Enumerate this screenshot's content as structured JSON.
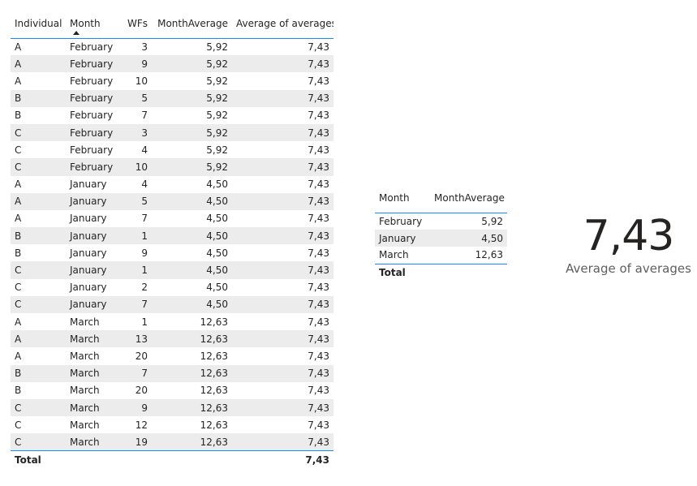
{
  "main_table": {
    "columns": [
      "Individual",
      "Month",
      "WFs",
      "MonthAverage",
      "Average of averages"
    ],
    "rows": [
      [
        "A",
        "February",
        "3",
        "5,92",
        "7,43"
      ],
      [
        "A",
        "February",
        "9",
        "5,92",
        "7,43"
      ],
      [
        "A",
        "February",
        "10",
        "5,92",
        "7,43"
      ],
      [
        "B",
        "February",
        "5",
        "5,92",
        "7,43"
      ],
      [
        "B",
        "February",
        "7",
        "5,92",
        "7,43"
      ],
      [
        "C",
        "February",
        "3",
        "5,92",
        "7,43"
      ],
      [
        "C",
        "February",
        "4",
        "5,92",
        "7,43"
      ],
      [
        "C",
        "February",
        "10",
        "5,92",
        "7,43"
      ],
      [
        "A",
        "January",
        "4",
        "4,50",
        "7,43"
      ],
      [
        "A",
        "January",
        "5",
        "4,50",
        "7,43"
      ],
      [
        "A",
        "January",
        "7",
        "4,50",
        "7,43"
      ],
      [
        "B",
        "January",
        "1",
        "4,50",
        "7,43"
      ],
      [
        "B",
        "January",
        "9",
        "4,50",
        "7,43"
      ],
      [
        "C",
        "January",
        "1",
        "4,50",
        "7,43"
      ],
      [
        "C",
        "January",
        "2",
        "4,50",
        "7,43"
      ],
      [
        "C",
        "January",
        "7",
        "4,50",
        "7,43"
      ],
      [
        "A",
        "March",
        "1",
        "12,63",
        "7,43"
      ],
      [
        "A",
        "March",
        "13",
        "12,63",
        "7,43"
      ],
      [
        "A",
        "March",
        "20",
        "12,63",
        "7,43"
      ],
      [
        "B",
        "March",
        "7",
        "12,63",
        "7,43"
      ],
      [
        "B",
        "March",
        "20",
        "12,63",
        "7,43"
      ],
      [
        "C",
        "March",
        "9",
        "12,63",
        "7,43"
      ],
      [
        "C",
        "March",
        "12",
        "12,63",
        "7,43"
      ],
      [
        "C",
        "March",
        "19",
        "12,63",
        "7,43"
      ]
    ],
    "total_label": "Total",
    "total_value": "7,43"
  },
  "month_table": {
    "columns": [
      "Month",
      "MonthAverage"
    ],
    "rows": [
      [
        "February",
        "5,92"
      ],
      [
        "January",
        "4,50"
      ],
      [
        "March",
        "12,63"
      ]
    ],
    "total_label": "Total"
  },
  "kpi_card": {
    "value": "7,43",
    "label": "Average of averages"
  },
  "colors": {
    "accent": "#118dff",
    "stripe": "#ececec",
    "text": "#252423",
    "label": "#605e5c"
  },
  "icons": {
    "sort": "sort-ascending-icon"
  }
}
